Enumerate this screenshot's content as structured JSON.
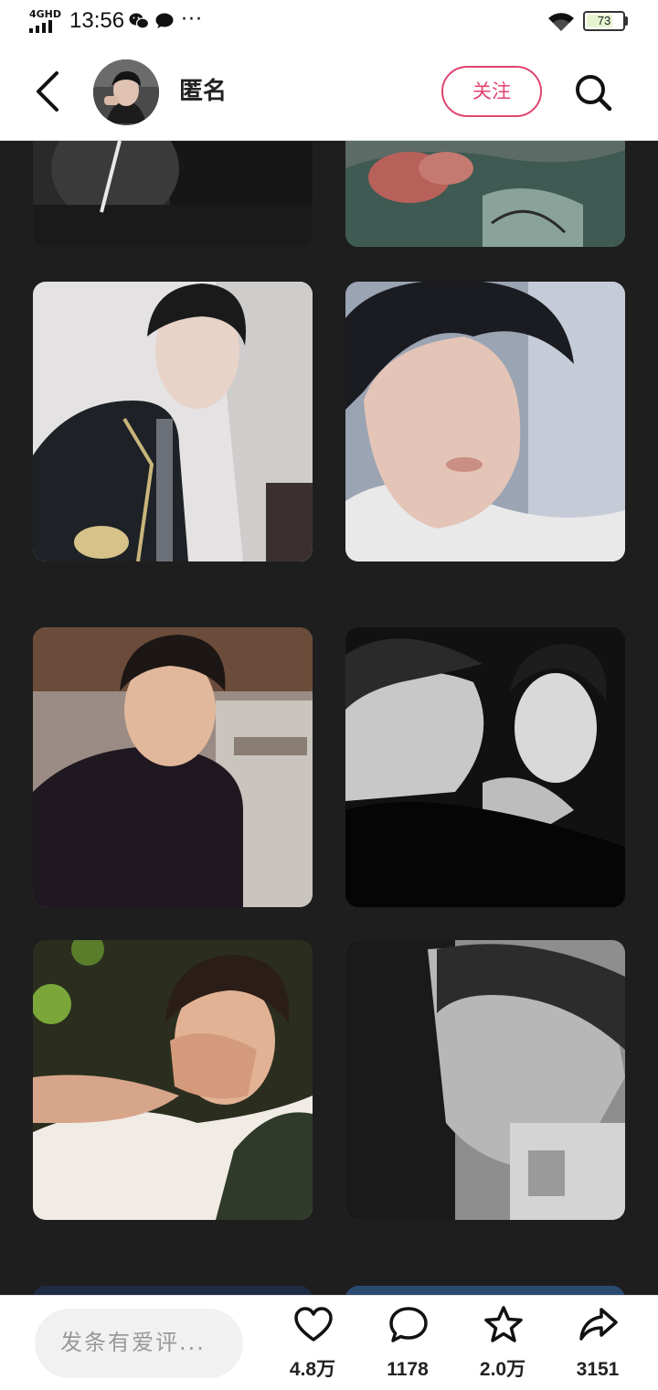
{
  "status_bar": {
    "network": "4GHD",
    "time": "13:56",
    "more": "···",
    "battery_level": 73
  },
  "header": {
    "username": "匿名",
    "follow_label": "关注"
  },
  "bottom_bar": {
    "comment_placeholder": "发条有爱评...",
    "like_count": "4.8万",
    "comment_count": "1178",
    "favorite_count": "2.0万",
    "share_count": "3151"
  },
  "colors": {
    "accent": "#e0456f",
    "feed_background": "#1e1e1e"
  }
}
